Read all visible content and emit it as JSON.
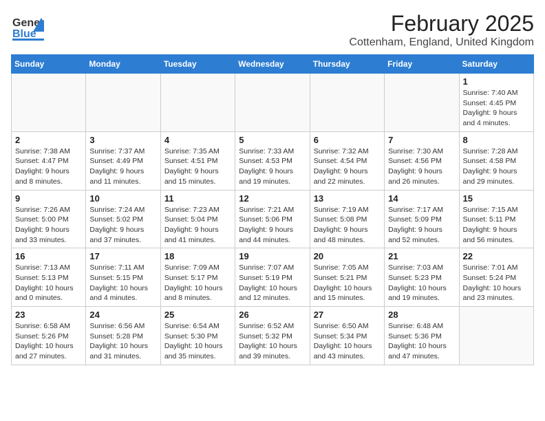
{
  "header": {
    "logo_line1": "General",
    "logo_line2": "Blue",
    "month": "February 2025",
    "location": "Cottenham, England, United Kingdom"
  },
  "weekdays": [
    "Sunday",
    "Monday",
    "Tuesday",
    "Wednesday",
    "Thursday",
    "Friday",
    "Saturday"
  ],
  "weeks": [
    [
      {
        "day": "",
        "info": ""
      },
      {
        "day": "",
        "info": ""
      },
      {
        "day": "",
        "info": ""
      },
      {
        "day": "",
        "info": ""
      },
      {
        "day": "",
        "info": ""
      },
      {
        "day": "",
        "info": ""
      },
      {
        "day": "1",
        "info": "Sunrise: 7:40 AM\nSunset: 4:45 PM\nDaylight: 9 hours and 4 minutes."
      }
    ],
    [
      {
        "day": "2",
        "info": "Sunrise: 7:38 AM\nSunset: 4:47 PM\nDaylight: 9 hours and 8 minutes."
      },
      {
        "day": "3",
        "info": "Sunrise: 7:37 AM\nSunset: 4:49 PM\nDaylight: 9 hours and 11 minutes."
      },
      {
        "day": "4",
        "info": "Sunrise: 7:35 AM\nSunset: 4:51 PM\nDaylight: 9 hours and 15 minutes."
      },
      {
        "day": "5",
        "info": "Sunrise: 7:33 AM\nSunset: 4:53 PM\nDaylight: 9 hours and 19 minutes."
      },
      {
        "day": "6",
        "info": "Sunrise: 7:32 AM\nSunset: 4:54 PM\nDaylight: 9 hours and 22 minutes."
      },
      {
        "day": "7",
        "info": "Sunrise: 7:30 AM\nSunset: 4:56 PM\nDaylight: 9 hours and 26 minutes."
      },
      {
        "day": "8",
        "info": "Sunrise: 7:28 AM\nSunset: 4:58 PM\nDaylight: 9 hours and 29 minutes."
      }
    ],
    [
      {
        "day": "9",
        "info": "Sunrise: 7:26 AM\nSunset: 5:00 PM\nDaylight: 9 hours and 33 minutes."
      },
      {
        "day": "10",
        "info": "Sunrise: 7:24 AM\nSunset: 5:02 PM\nDaylight: 9 hours and 37 minutes."
      },
      {
        "day": "11",
        "info": "Sunrise: 7:23 AM\nSunset: 5:04 PM\nDaylight: 9 hours and 41 minutes."
      },
      {
        "day": "12",
        "info": "Sunrise: 7:21 AM\nSunset: 5:06 PM\nDaylight: 9 hours and 44 minutes."
      },
      {
        "day": "13",
        "info": "Sunrise: 7:19 AM\nSunset: 5:08 PM\nDaylight: 9 hours and 48 minutes."
      },
      {
        "day": "14",
        "info": "Sunrise: 7:17 AM\nSunset: 5:09 PM\nDaylight: 9 hours and 52 minutes."
      },
      {
        "day": "15",
        "info": "Sunrise: 7:15 AM\nSunset: 5:11 PM\nDaylight: 9 hours and 56 minutes."
      }
    ],
    [
      {
        "day": "16",
        "info": "Sunrise: 7:13 AM\nSunset: 5:13 PM\nDaylight: 10 hours and 0 minutes."
      },
      {
        "day": "17",
        "info": "Sunrise: 7:11 AM\nSunset: 5:15 PM\nDaylight: 10 hours and 4 minutes."
      },
      {
        "day": "18",
        "info": "Sunrise: 7:09 AM\nSunset: 5:17 PM\nDaylight: 10 hours and 8 minutes."
      },
      {
        "day": "19",
        "info": "Sunrise: 7:07 AM\nSunset: 5:19 PM\nDaylight: 10 hours and 12 minutes."
      },
      {
        "day": "20",
        "info": "Sunrise: 7:05 AM\nSunset: 5:21 PM\nDaylight: 10 hours and 15 minutes."
      },
      {
        "day": "21",
        "info": "Sunrise: 7:03 AM\nSunset: 5:23 PM\nDaylight: 10 hours and 19 minutes."
      },
      {
        "day": "22",
        "info": "Sunrise: 7:01 AM\nSunset: 5:24 PM\nDaylight: 10 hours and 23 minutes."
      }
    ],
    [
      {
        "day": "23",
        "info": "Sunrise: 6:58 AM\nSunset: 5:26 PM\nDaylight: 10 hours and 27 minutes."
      },
      {
        "day": "24",
        "info": "Sunrise: 6:56 AM\nSunset: 5:28 PM\nDaylight: 10 hours and 31 minutes."
      },
      {
        "day": "25",
        "info": "Sunrise: 6:54 AM\nSunset: 5:30 PM\nDaylight: 10 hours and 35 minutes."
      },
      {
        "day": "26",
        "info": "Sunrise: 6:52 AM\nSunset: 5:32 PM\nDaylight: 10 hours and 39 minutes."
      },
      {
        "day": "27",
        "info": "Sunrise: 6:50 AM\nSunset: 5:34 PM\nDaylight: 10 hours and 43 minutes."
      },
      {
        "day": "28",
        "info": "Sunrise: 6:48 AM\nSunset: 5:36 PM\nDaylight: 10 hours and 47 minutes."
      },
      {
        "day": "",
        "info": ""
      }
    ]
  ]
}
